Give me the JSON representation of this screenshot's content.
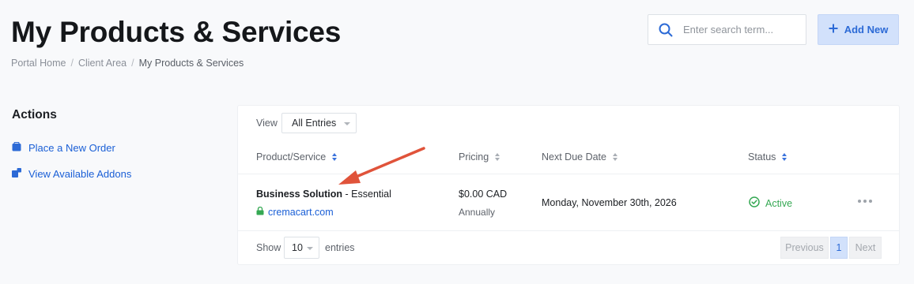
{
  "header": {
    "title": "My Products & Services",
    "search": {
      "placeholder": "Enter search term..."
    },
    "add_new_label": "Add New"
  },
  "breadcrumb": [
    {
      "label": "Portal Home"
    },
    {
      "label": "Client Area"
    },
    {
      "label": "My Products & Services"
    }
  ],
  "sidebar": {
    "title": "Actions",
    "items": [
      {
        "label": "Place a New Order",
        "icon": "cart-icon"
      },
      {
        "label": "View Available Addons",
        "icon": "addons-icon"
      }
    ]
  },
  "table": {
    "view_label": "View",
    "view_selected": "All Entries",
    "columns": [
      {
        "label": "Product/Service",
        "sort": "active"
      },
      {
        "label": "Pricing"
      },
      {
        "label": "Next Due Date"
      },
      {
        "label": "Status",
        "sort": "active"
      }
    ],
    "rows": [
      {
        "product_name": "Business Solution",
        "product_variant": " - Essential",
        "domain": "cremacart.com",
        "price": "$0.00 CAD",
        "cycle": "Annually",
        "next_due": "Monday, November 30th, 2026",
        "status": "Active"
      }
    ],
    "footer": {
      "show_label": "Show",
      "entries_value": "10",
      "entries_label": "entries",
      "prev_label": "Previous",
      "page": "1",
      "next_label": "Next"
    }
  },
  "colors": {
    "accent": "#2c6ad6",
    "link": "#1a5fd6",
    "status_active": "#35a853",
    "annotation_arrow": "#e0533a"
  }
}
